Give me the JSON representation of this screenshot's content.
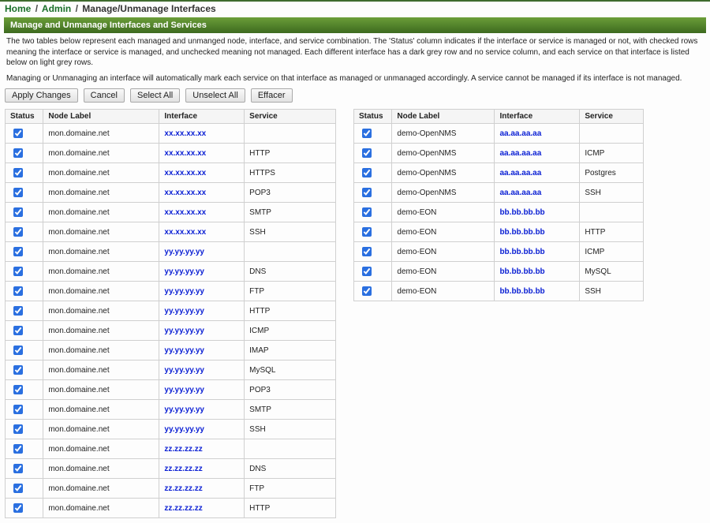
{
  "breadcrumb": {
    "home": "Home",
    "admin": "Admin",
    "current": "Manage/Unmanage Interfaces"
  },
  "panel_title": "Manage and Unmanage Interfaces and Services",
  "description_p1": "The two tables below represent each managed and unmanged node, interface, and service combination. The 'Status' column indicates if the interface or service is managed or not, with checked rows meaning the interface or service is managed, and unchecked meaning not managed. Each different interface has a dark grey row and no service column, and each service on that interface is listed below on light grey rows.",
  "description_p2": "Managing or Unmanaging an interface will automatically mark each service on that interface as managed or unmanaged accordingly. A service cannot be managed if its interface is not managed.",
  "buttons": {
    "apply": "Apply Changes",
    "cancel": "Cancel",
    "select_all": "Select All",
    "unselect_all": "Unselect All",
    "effacer": "Effacer"
  },
  "columns": {
    "status": "Status",
    "node": "Node Label",
    "interface": "Interface",
    "service": "Service"
  },
  "left_rows": [
    {
      "node": "mon.domaine.net",
      "iface": "xx.xx.xx.xx",
      "svc": ""
    },
    {
      "node": "mon.domaine.net",
      "iface": "xx.xx.xx.xx",
      "svc": "HTTP"
    },
    {
      "node": "mon.domaine.net",
      "iface": "xx.xx.xx.xx",
      "svc": "HTTPS"
    },
    {
      "node": "mon.domaine.net",
      "iface": "xx.xx.xx.xx",
      "svc": "POP3"
    },
    {
      "node": "mon.domaine.net",
      "iface": "xx.xx.xx.xx",
      "svc": "SMTP"
    },
    {
      "node": "mon.domaine.net",
      "iface": "xx.xx.xx.xx",
      "svc": "SSH"
    },
    {
      "node": "mon.domaine.net",
      "iface": "yy.yy.yy.yy",
      "svc": ""
    },
    {
      "node": "mon.domaine.net",
      "iface": "yy.yy.yy.yy",
      "svc": "DNS"
    },
    {
      "node": "mon.domaine.net",
      "iface": "yy.yy.yy.yy",
      "svc": "FTP"
    },
    {
      "node": "mon.domaine.net",
      "iface": "yy.yy.yy.yy",
      "svc": "HTTP"
    },
    {
      "node": "mon.domaine.net",
      "iface": "yy.yy.yy.yy",
      "svc": "ICMP"
    },
    {
      "node": "mon.domaine.net",
      "iface": "yy.yy.yy.yy",
      "svc": "IMAP"
    },
    {
      "node": "mon.domaine.net",
      "iface": "yy.yy.yy.yy",
      "svc": "MySQL"
    },
    {
      "node": "mon.domaine.net",
      "iface": "yy.yy.yy.yy",
      "svc": "POP3"
    },
    {
      "node": "mon.domaine.net",
      "iface": "yy.yy.yy.yy",
      "svc": "SMTP"
    },
    {
      "node": "mon.domaine.net",
      "iface": "yy.yy.yy.yy",
      "svc": "SSH"
    },
    {
      "node": "mon.domaine.net",
      "iface": "zz.zz.zz.zz",
      "svc": ""
    },
    {
      "node": "mon.domaine.net",
      "iface": "zz.zz.zz.zz",
      "svc": "DNS"
    },
    {
      "node": "mon.domaine.net",
      "iface": "zz.zz.zz.zz",
      "svc": "FTP"
    },
    {
      "node": "mon.domaine.net",
      "iface": "zz.zz.zz.zz",
      "svc": "HTTP"
    }
  ],
  "right_rows": [
    {
      "node": "demo-OpenNMS",
      "iface": "aa.aa.aa.aa",
      "svc": ""
    },
    {
      "node": "demo-OpenNMS",
      "iface": "aa.aa.aa.aa",
      "svc": "ICMP"
    },
    {
      "node": "demo-OpenNMS",
      "iface": "aa.aa.aa.aa",
      "svc": "Postgres"
    },
    {
      "node": "demo-OpenNMS",
      "iface": "aa.aa.aa.aa",
      "svc": "SSH"
    },
    {
      "node": "demo-EON",
      "iface": "bb.bb.bb.bb",
      "svc": ""
    },
    {
      "node": "demo-EON",
      "iface": "bb.bb.bb.bb",
      "svc": "HTTP"
    },
    {
      "node": "demo-EON",
      "iface": "bb.bb.bb.bb",
      "svc": "ICMP"
    },
    {
      "node": "demo-EON",
      "iface": "bb.bb.bb.bb",
      "svc": "MySQL"
    },
    {
      "node": "demo-EON",
      "iface": "bb.bb.bb.bb",
      "svc": "SSH"
    }
  ]
}
